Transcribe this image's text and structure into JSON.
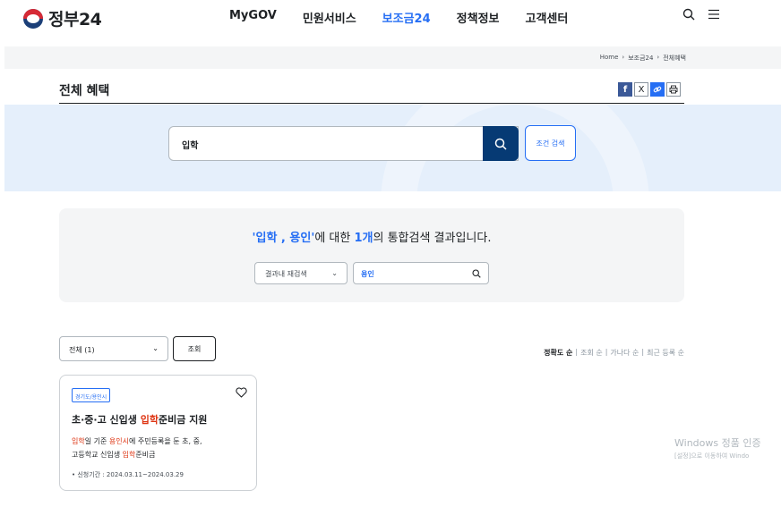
{
  "header": {
    "logo_text": "정부24",
    "nav": [
      "MyGOV",
      "민원서비스",
      "보조금24",
      "정책정보",
      "고객센터"
    ],
    "active_nav": "보조금24"
  },
  "breadcrumb": [
    "Home",
    "보조금24",
    "전체혜택"
  ],
  "page_title": "전체 혜택",
  "share": {
    "facebook": "f",
    "x": "X"
  },
  "search": {
    "value": "입학",
    "condition_label": "조건 검색"
  },
  "summary": {
    "quote_open": "'",
    "keywords": "입학 , 용인",
    "quote_close": "'",
    "mid_text": "에 대한 ",
    "count": "1개",
    "tail_text": "의 통합검색 결과입니다."
  },
  "refine": {
    "select_label": "결과내 재검색",
    "input_value": "용인"
  },
  "filter": {
    "select_label": "전체 (1)",
    "query_label": "조회"
  },
  "sort": {
    "items": [
      "정확도 순",
      "조회 순",
      "가나다 순",
      "최근 등록 순"
    ],
    "active": "정확도 순"
  },
  "card": {
    "tag": "경기도/용인시",
    "title_pre": "초·중·고 신입생 ",
    "title_hl": "입학",
    "title_post": "준비금 지원",
    "desc_1_hl": "입학",
    "desc_1a": "일 기준 ",
    "desc_1_hl2": "용인시",
    "desc_1b": "에 주민등록을 둔 초, 중,",
    "desc_2a": "고등학교 신입생 ",
    "desc_2_hl": "입학",
    "desc_2b": "준비금",
    "period": "• 신청기간 : 2024.03.11~2024.03.29"
  },
  "watermark": {
    "line1": "Windows 정품 인증",
    "line2": "[설정]으로 이동하여 Windo"
  },
  "colors": {
    "primary": "#256ef4",
    "navy": "#063a74",
    "highlight_red": "#de3412",
    "band": "#e5effb"
  }
}
